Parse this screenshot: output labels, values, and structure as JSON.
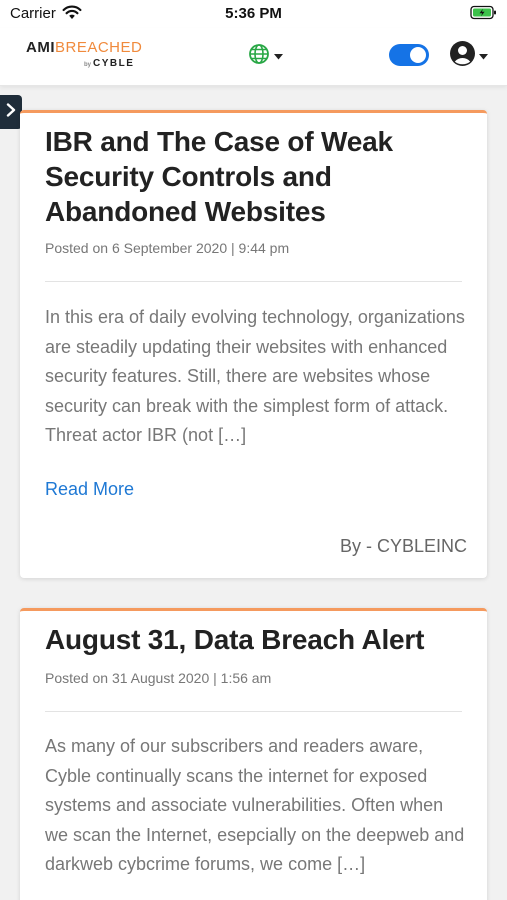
{
  "status_bar": {
    "carrier": "Carrier",
    "time": "5:36 PM"
  },
  "header": {
    "logo_primary": "AMI",
    "logo_accent": "BREACHED",
    "logo_by": "by",
    "logo_brand": "CYBLE",
    "theme_toggle_on": true,
    "accent_color": "#1573e6",
    "logo_accent_color": "#f08a3c"
  },
  "posts": [
    {
      "title": "IBR and The Case of Weak Security Controls and Abandoned Websites",
      "meta": "Posted on 6 September 2020 | 9:44 pm",
      "excerpt": "In this era of daily evolving technology, organizations are steadily updating their websites with enhanced security features. Still, there are websites whose security can break with the simplest form of attack. Threat actor IBR (not […]",
      "read_more": "Read More",
      "author": "By - CYBLEINC"
    },
    {
      "title": "August 31, Data Breach Alert",
      "meta": "Posted on 31 August 2020 | 1:56 am",
      "excerpt": "As many of our subscribers and readers aware, Cyble continually scans the internet for exposed systems and associate vulnerabilities. Often when we scan the Internet, esepcially on the deepweb and darkweb cybcrime forums, we come […]"
    }
  ],
  "icons": {
    "wifi": "wifi-icon",
    "battery": "battery-charging-icon",
    "language": "globe-icon",
    "user": "user-circle-icon",
    "sidebar": "chevron-right-icon"
  },
  "card_accent_color": "#f59a5e"
}
